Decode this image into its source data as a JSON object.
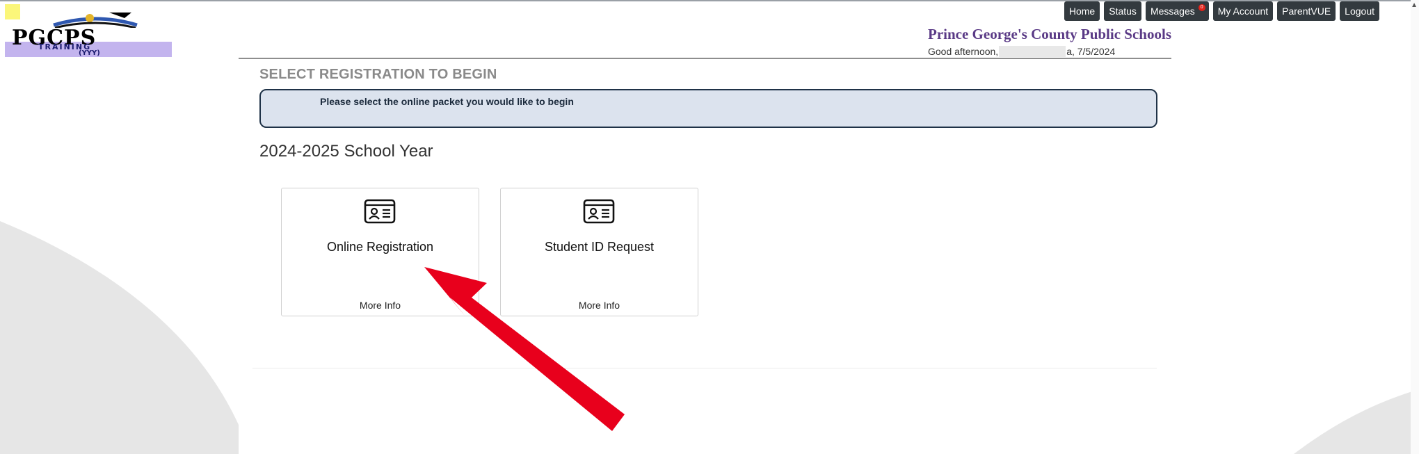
{
  "header": {
    "logo_text": "PGCPS",
    "logo_subtitle": "TRAINING",
    "logo_subtitle2": "(YYY)",
    "school_name": "Prince George's County Public Schools",
    "greeting_prefix": "Good afternoon,",
    "greeting_suffix": "a, 7/5/2024"
  },
  "nav": {
    "items": [
      {
        "label": "Home"
      },
      {
        "label": "Status"
      },
      {
        "label": "Messages",
        "badge": "0"
      },
      {
        "label": "My Account"
      },
      {
        "label": "ParentVUE"
      },
      {
        "label": "Logout"
      }
    ]
  },
  "main": {
    "title": "SELECT REGISTRATION TO BEGIN",
    "info": "Please select the online packet you would like to begin",
    "school_year": "2024-2025 School Year",
    "cards": [
      {
        "title": "Online Registration",
        "more": "More Info",
        "icon": "id-card-icon"
      },
      {
        "title": "Student ID Request",
        "more": "More Info",
        "icon": "id-card-icon"
      }
    ]
  },
  "colors": {
    "nav_bg": "#333a3f",
    "school_name": "#5a3a86",
    "info_bg": "#dce3ee",
    "info_border": "#1f3247",
    "arrow": "#e8001c"
  }
}
